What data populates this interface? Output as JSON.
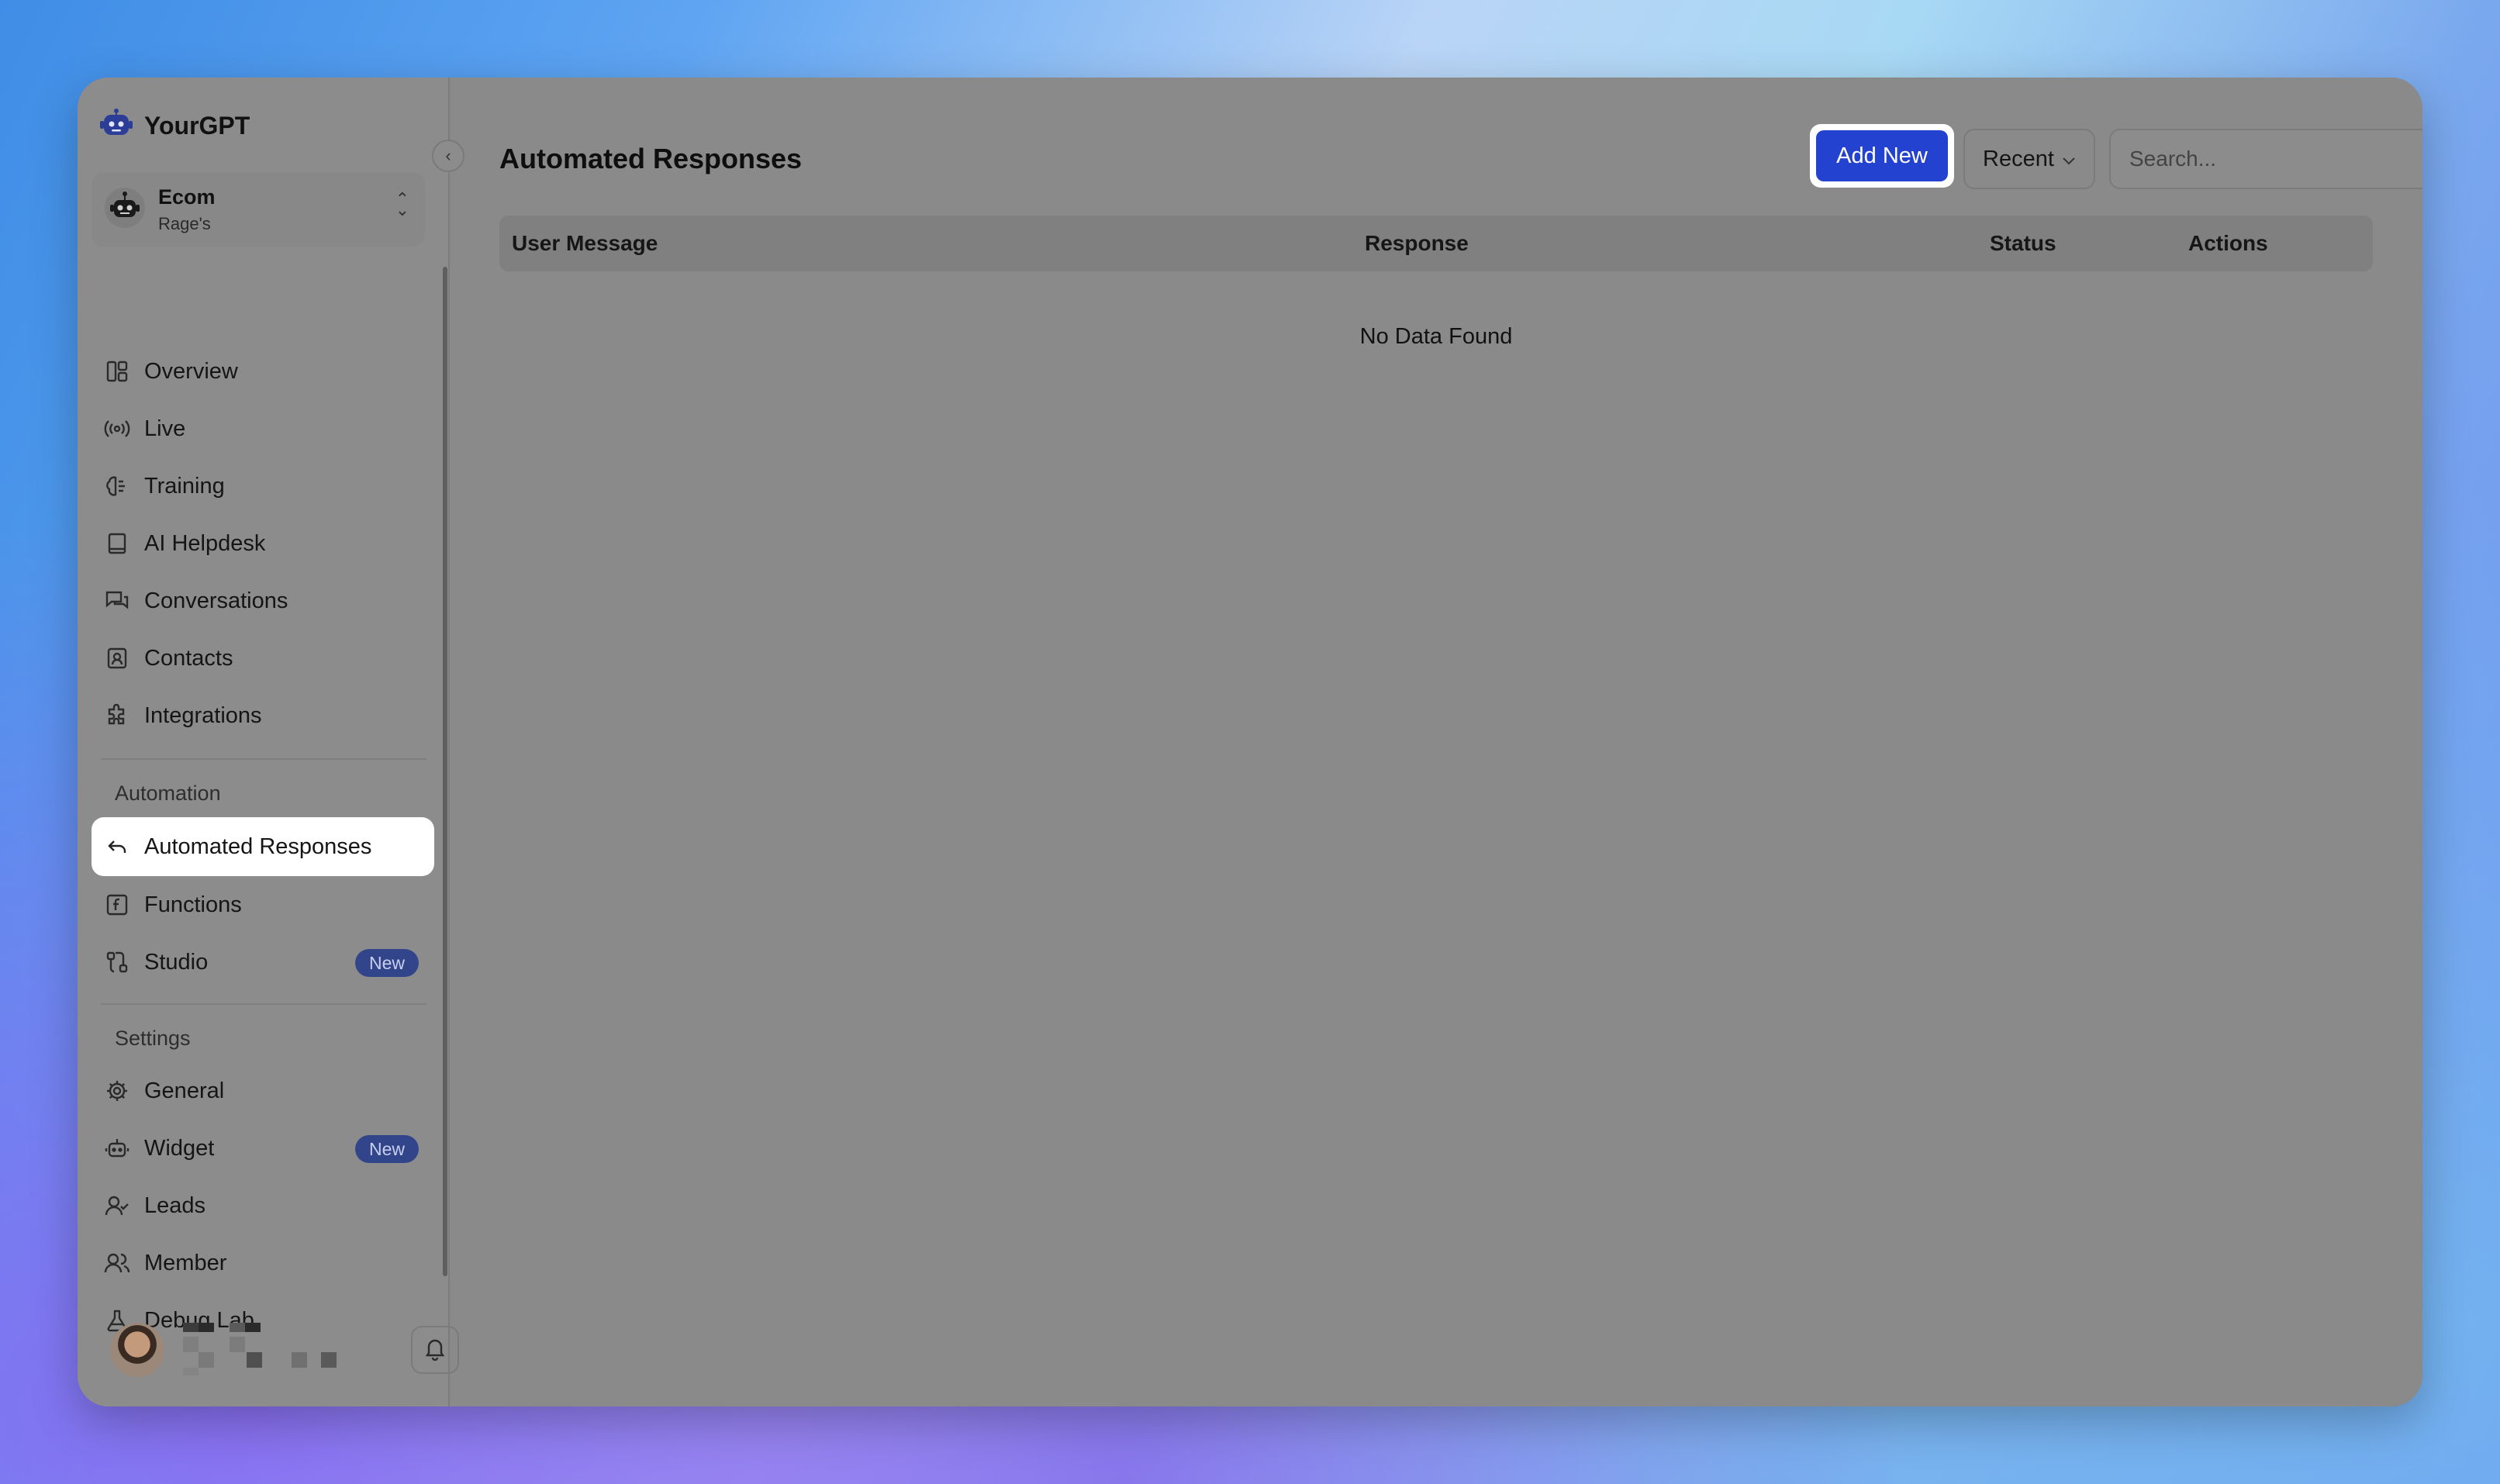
{
  "brand": {
    "name": "YourGPT"
  },
  "workspace": {
    "name": "Ecom",
    "subtitle": "Rage's"
  },
  "nav_main": [
    {
      "label": "Overview",
      "icon": "layout-icon"
    },
    {
      "label": "Live",
      "icon": "broadcast-icon"
    },
    {
      "label": "Training",
      "icon": "brain-icon"
    },
    {
      "label": "AI Helpdesk",
      "icon": "book-icon"
    },
    {
      "label": "Conversations",
      "icon": "chat-icon"
    },
    {
      "label": "Contacts",
      "icon": "contact-icon"
    },
    {
      "label": "Integrations",
      "icon": "puzzle-icon"
    }
  ],
  "automation": {
    "section_label": "Automation",
    "items": [
      {
        "label": "Automated Responses",
        "icon": "reply-icon",
        "active": true
      },
      {
        "label": "Functions",
        "icon": "function-icon"
      },
      {
        "label": "Studio",
        "icon": "flow-icon",
        "badge": "New"
      }
    ]
  },
  "settings": {
    "section_label": "Settings",
    "items": [
      {
        "label": "General",
        "icon": "gear-icon"
      },
      {
        "label": "Widget",
        "icon": "bot-icon",
        "badge": "New"
      },
      {
        "label": "Leads",
        "icon": "user-check-icon"
      },
      {
        "label": "Member",
        "icon": "users-icon"
      },
      {
        "label": "Debug Lab",
        "icon": "flask-icon"
      }
    ]
  },
  "header": {
    "title": "Automated Responses",
    "add_button": "Add New",
    "sort_label": "Recent",
    "search_placeholder": "Search..."
  },
  "table": {
    "columns": [
      "User Message",
      "Response",
      "Status",
      "Actions"
    ],
    "empty_text": "No Data Found"
  },
  "colors": {
    "accent": "#2342cf",
    "badge_bg": "#33458a",
    "fab_bg": "#0f1a2c"
  }
}
